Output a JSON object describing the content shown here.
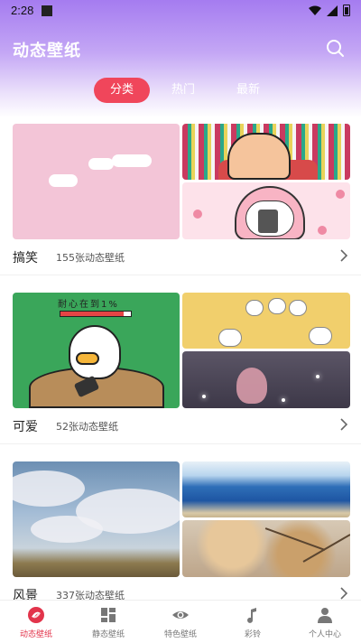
{
  "status_bar": {
    "time": "2:28"
  },
  "header": {
    "title": "动态壁纸"
  },
  "tabs": [
    {
      "label": "分类",
      "active": true
    },
    {
      "label": "热门",
      "active": false
    },
    {
      "label": "最新",
      "active": false
    }
  ],
  "categories": [
    {
      "name": "搞笑",
      "count": "155张动态壁纸"
    },
    {
      "name": "可爱",
      "count": "52张动态壁纸"
    },
    {
      "name": "风景",
      "count": "337张动态壁纸"
    }
  ],
  "cute_bar_text": "耐心在到1%",
  "bottom_nav": [
    {
      "label": "动态壁纸",
      "icon": "dynamic-wallpaper-icon",
      "active": true
    },
    {
      "label": "静态壁纸",
      "icon": "static-wallpaper-icon",
      "active": false
    },
    {
      "label": "特色壁纸",
      "icon": "eye-icon",
      "active": false
    },
    {
      "label": "彩铃",
      "icon": "ringtone-icon",
      "active": false
    },
    {
      "label": "个人中心",
      "icon": "person-icon",
      "active": false
    }
  ],
  "colors": {
    "accent": "#f0465b",
    "header_gradient_top": "#a57cf0",
    "nav_active": "#e2344b"
  }
}
